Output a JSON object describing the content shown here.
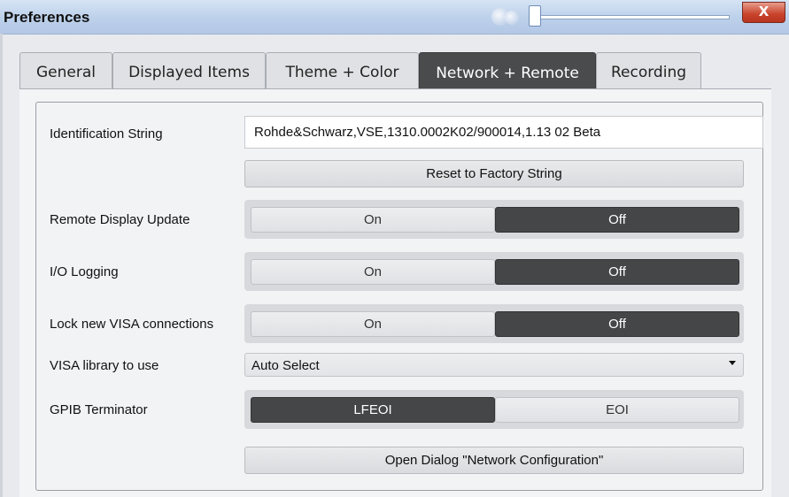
{
  "window": {
    "title": "Preferences",
    "close_label": "X"
  },
  "tabs": [
    {
      "label": "General",
      "active": false
    },
    {
      "label": "Displayed Items",
      "active": false
    },
    {
      "label": "Theme + Color",
      "active": false
    },
    {
      "label": "Network + Remote",
      "active": true
    },
    {
      "label": "Recording",
      "active": false
    }
  ],
  "identification": {
    "label": "Identification String",
    "value": "Rohde&Schwarz,VSE,1310.0002K02/900014,1.13 02 Beta",
    "reset_label": "Reset to Factory String"
  },
  "remote_display_update": {
    "label": "Remote Display Update",
    "on": "On",
    "off": "Off",
    "selected": "Off"
  },
  "io_logging": {
    "label": "I/O Logging",
    "on": "On",
    "off": "Off",
    "selected": "Off"
  },
  "lock_visa": {
    "label": "Lock new VISA connections",
    "on": "On",
    "off": "Off",
    "selected": "Off"
  },
  "visa_library": {
    "label": "VISA library to use",
    "value": "Auto Select"
  },
  "gpib_terminator": {
    "label": "GPIB Terminator",
    "opt1": "LFEOI",
    "opt2": "EOI",
    "selected": "LFEOI"
  },
  "network_dialog": {
    "label": "Open Dialog \"Network Configuration\""
  },
  "colors": {
    "accent_dark": "#454648",
    "close_red": "#c8432a",
    "titlebar": "#bcd0ea"
  }
}
